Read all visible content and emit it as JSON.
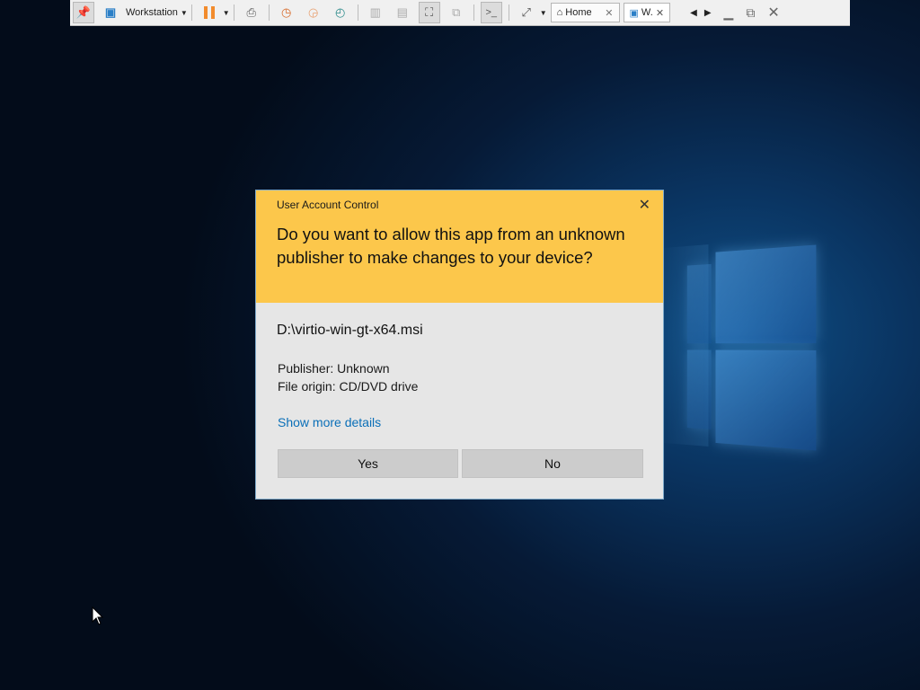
{
  "vmware_toolbar": {
    "workstation_label": "Workstation",
    "tabs": [
      {
        "label": "Home"
      },
      {
        "label": "W."
      }
    ]
  },
  "uac": {
    "title": "User Account Control",
    "question": "Do you want to allow this app from an unknown publisher to make changes to your device?",
    "app_path": "D:\\virtio-win-gt-x64.msi",
    "publisher": "Publisher: Unknown",
    "file_origin": "File origin: CD/DVD drive",
    "details_link": "Show more details",
    "yes_label": "Yes",
    "no_label": "No"
  },
  "colors": {
    "header": "#fcc74b",
    "body": "#e6e6e6",
    "link": "#0a6fb8",
    "pause": "#f28b2c"
  }
}
